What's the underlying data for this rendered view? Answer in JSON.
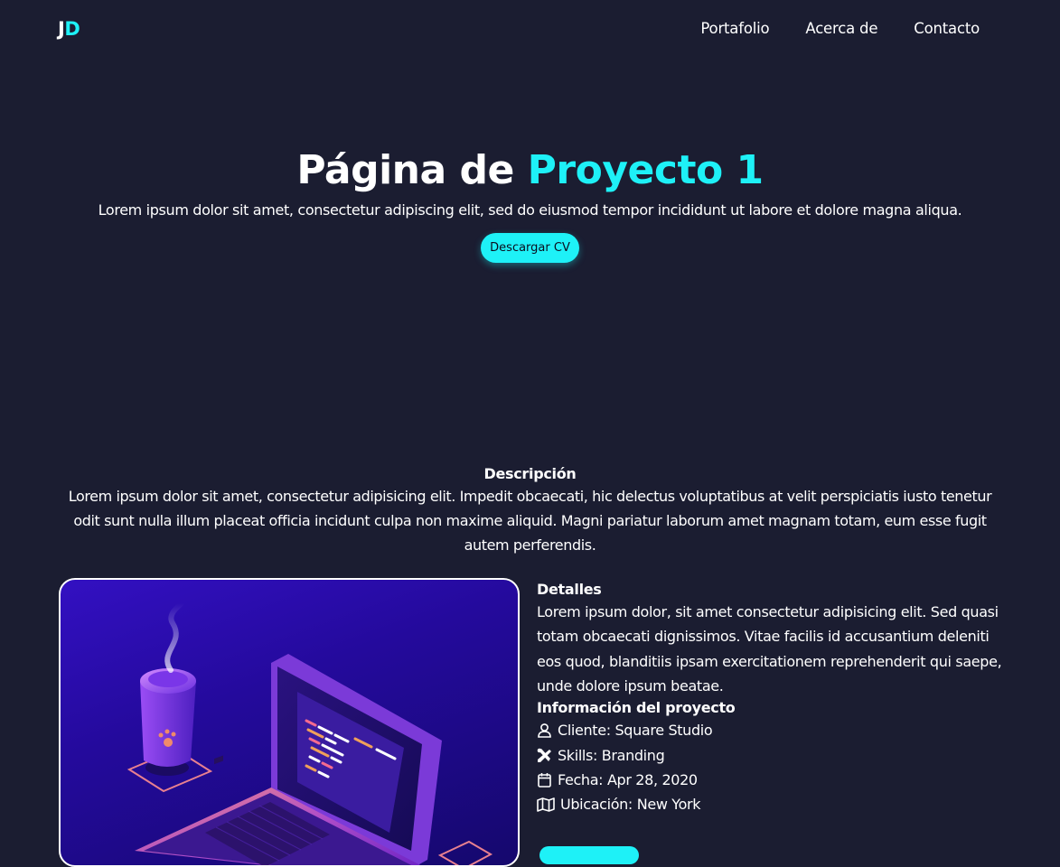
{
  "navbar": {
    "logo": {
      "first": "J",
      "second": "D"
    },
    "links": [
      "Portafolio",
      "Acerca de",
      "Contacto"
    ]
  },
  "hero": {
    "title_prefix": "Página de",
    "title_accent": "Proyecto 1",
    "subtitle": "Lorem ipsum dolor sit amet, consectetur adipiscing elit, sed do eiusmod tempor incididunt ut labore et dolore magna aliqua.",
    "cv_button": "Descargar CV"
  },
  "description": {
    "heading": "Descripción",
    "text": "Lorem ipsum dolor sit amet, consectetur adipisicing elit. Impedit obcaecati, hic delectus voluptatibus at velit perspiciatis iusto tenetur odit sunt nulla illum placeat officia incidunt culpa non maxime aliquid. Magni pariatur laborum amet magnam totam, eum esse fugit autem perferendis."
  },
  "details": {
    "heading": "Detalles",
    "text": "Lorem ipsum dolor, sit amet consectetur adipisicing elit. Sed quasi totam obcaecati dignissimos. Vitae facilis id accusantium deleniti eos quod, blanditiis ipsam exercitationem reprehenderit qui saepe, unde dolore ipsum beatae.",
    "info_heading": "Información del proyecto",
    "info": [
      {
        "icon": "user-icon",
        "text": "Cliente: Square Studio"
      },
      {
        "icon": "tools-icon",
        "text": "Skills: Branding"
      },
      {
        "icon": "calendar-icon",
        "text": "Fecha: Apr 28, 2020"
      },
      {
        "icon": "map-icon",
        "text": "Ubicación: New York"
      }
    ]
  },
  "colors": {
    "background": "#1b1d31",
    "accent": "#1ef1f7",
    "text": "#ffffff"
  }
}
